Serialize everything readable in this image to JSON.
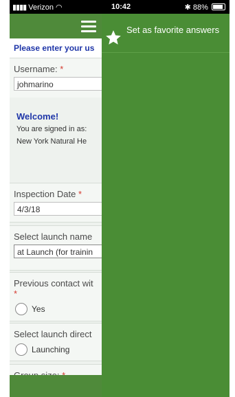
{
  "status_bar": {
    "carrier": "Verizon",
    "time": "10:42",
    "battery": "88%"
  },
  "form": {
    "instruction": "Please enter your us",
    "username": {
      "label": "Username:",
      "required_mark": "*",
      "value": "johmarino"
    },
    "welcome": {
      "title": "Welcome!",
      "line1": "You are signed in as:",
      "line2": "New York Natural He"
    },
    "inspection_date": {
      "label": "Inspection Date",
      "required_mark": "*",
      "value": "4/3/18"
    },
    "launch_name": {
      "label": "Select launch name",
      "value": "at Launch (for trainin"
    },
    "previous_contact": {
      "label": "Previous contact wit",
      "required_mark": "*",
      "option_yes": "Yes"
    },
    "launch_direction": {
      "label": "Select launch direct",
      "option_launching": "Launching"
    },
    "group_size": {
      "label": "Group size:",
      "required_mark": "*"
    }
  },
  "drawer": {
    "favorite_label": "Set as favorite answers"
  },
  "colors": {
    "accent_green": "#4a8d35",
    "link_blue": "#1f36a8",
    "required_red": "#d43a2f"
  },
  "icons": {
    "menu": "hamburger-icon",
    "favorite": "star-icon",
    "wifi": "wifi-icon",
    "bluetooth": "bluetooth-icon",
    "battery": "battery-icon"
  }
}
